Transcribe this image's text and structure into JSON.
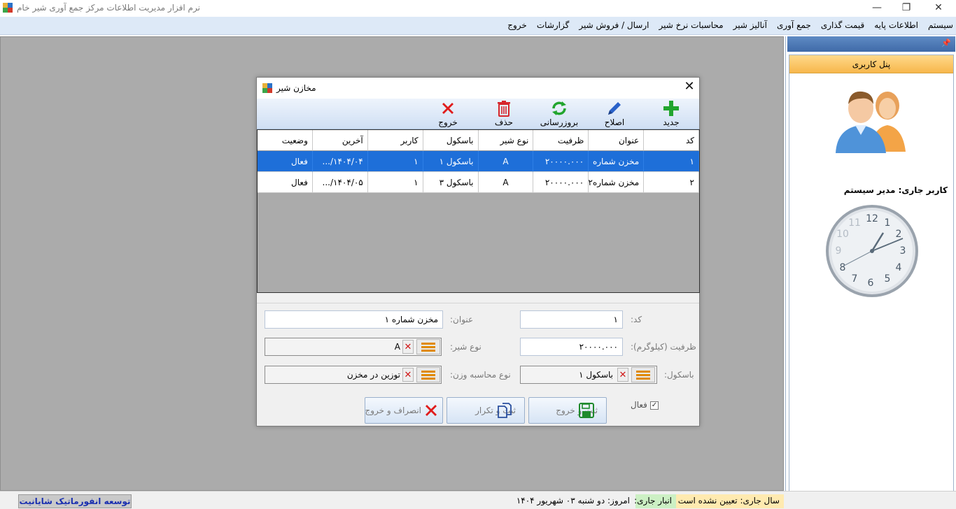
{
  "window": {
    "title": "نرم افزار مدیریت اطلاعات مرکز جمع آوری شیر خام",
    "minimize_glyph": "—",
    "restore_glyph": "❐",
    "close_glyph": "✕"
  },
  "menu": {
    "items": [
      "سیستم",
      "اطلاعات پایه",
      "قیمت گذاری",
      "جمع آوری",
      "آنالیز شیر",
      "محاسبات نرخ شیر",
      "ارسال / فروش شیر",
      "گزارشات",
      "خروج"
    ]
  },
  "right_panel": {
    "pin_glyph": "📌",
    "header": "پنل کاربری",
    "current_user": "کاربر جاری: مدیر سیستم",
    "clock_numbers": [
      "12",
      "1",
      "2",
      "3",
      "4",
      "5",
      "6",
      "7",
      "8",
      "9",
      "10",
      "11"
    ]
  },
  "statusbar": {
    "year": "سال جاری: تعیین نشده است",
    "store": "انبار جاری:",
    "today": "امروز: دو شنبه ۰۳ شهریور ۱۴۰۴",
    "developer": "توسعه انفورماتیک شایانیت"
  },
  "dialog": {
    "title": "مخازن شیر",
    "close_glyph": "✕",
    "toolbar": {
      "new": "جدید",
      "edit": "اصلاح",
      "refresh": "بروزرسانی",
      "delete": "حذف",
      "exit": "خروج"
    },
    "grid": {
      "columns": [
        "کد",
        "عنوان",
        "ظرفیت",
        "نوع شیر",
        "باسکول",
        "کاربر",
        "آخرین",
        "وضعیت"
      ],
      "rows": [
        [
          "۱",
          "مخزن شماره ۱",
          "۲۰۰۰۰.۰۰۰",
          "A",
          "باسکول ۱",
          "۱",
          "۱۴۰۴/۰۴/...",
          "فعال"
        ],
        [
          "۲",
          "مخزن شماره۲",
          "۲۰۰۰۰.۰۰۰",
          "A",
          "باسکول ۳",
          "۱",
          "۱۴۰۴/۰۵/...",
          "فعال"
        ]
      ],
      "selected_row": 0
    },
    "form": {
      "code_label": "کد:",
      "code_value": "۱",
      "title_label": "عنوان:",
      "title_value": "مخزن شماره ۱",
      "capacity_label": "ظرفیت (کیلوگرم):",
      "capacity_value": "۲۰۰۰۰.۰۰۰",
      "milk_type_label": "نوع شیر:",
      "milk_type_value": "A",
      "scale_label": "باسکول:",
      "scale_value": "باسکول ۱",
      "weight_calc_label": "نوع محاسبه وزن:",
      "weight_calc_value": "توزین در مخزن",
      "active_label": "فعال",
      "active_checked": true,
      "clear_glyph": "✕",
      "check_glyph": "✓"
    },
    "actions": {
      "save_exit": "ثبت و خروج",
      "save_repeat": "ثبت و تکرار",
      "cancel_exit": "انصراف و خروج"
    }
  }
}
